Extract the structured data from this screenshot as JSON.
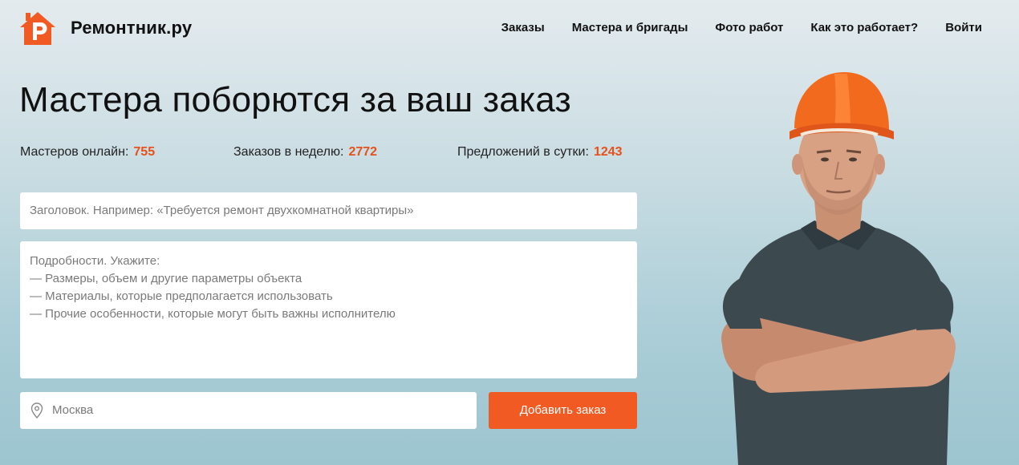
{
  "header": {
    "logo_text": "Ремонтник.ру",
    "nav": [
      "Заказы",
      "Мастера и бригады",
      "Фото работ",
      "Как это работает?"
    ],
    "login": "Войти"
  },
  "hero": {
    "title": "Мастера поборются за ваш заказ",
    "stats": [
      {
        "label": "Мастеров онлайн:",
        "value": "755"
      },
      {
        "label": "Заказов в неделю:",
        "value": "2772"
      },
      {
        "label": "Предложений в сутки:",
        "value": "1243"
      }
    ]
  },
  "form": {
    "title_placeholder": "Заголовок. Например: «Требуется ремонт двухкомнатной квартиры»",
    "details_lines": [
      "Подробности. Укажите:",
      "— Размеры, объем и другие параметры объекта",
      "— Материалы, которые предполагается использовать",
      "— Прочие особенности, которые могут быть важны исполнителю"
    ],
    "city_placeholder": "Москва",
    "submit_label": "Добавить заказ"
  },
  "colors": {
    "accent": "#f15a22",
    "stat_number": "#e8501a",
    "background_top": "#e4ebee",
    "background_bottom": "#9cc5d0"
  },
  "icons": {
    "logo": "house-r-logo-icon",
    "city": "map-pin-icon"
  }
}
